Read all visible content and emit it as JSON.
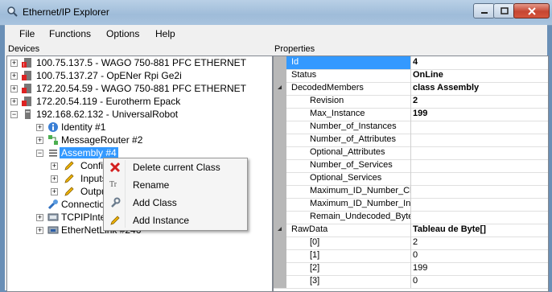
{
  "window": {
    "title": "Ethernet/IP Explorer"
  },
  "menu": [
    "File",
    "Functions",
    "Options",
    "Help"
  ],
  "panels": {
    "devices_label": "Devices",
    "properties_label": "Properties"
  },
  "tree": {
    "devices": [
      "100.75.137.5 - WAGO 750-881 PFC ETHERNET",
      "100.75.137.27 - OpENer Rpi Ge2i",
      "172.20.54.59 - WAGO 750-881 PFC ETHERNET",
      "172.20.54.119 - Eurotherm Epack",
      "192.168.62.132 - UniversalRobot"
    ],
    "children": [
      "Identity #1",
      "MessageRouter #2",
      "Assembly #4"
    ],
    "assembly_children": [
      "Config",
      "Inputs",
      "Outputs"
    ],
    "more": [
      "Connection",
      "TCPIPInterf",
      "EtherNetLink #246"
    ]
  },
  "context_menu": {
    "items": [
      "Delete current Class",
      "Rename",
      "Add Class",
      "Add Instance"
    ],
    "rename_glyph": "Tr"
  },
  "properties": [
    {
      "key": "Id",
      "value": "4"
    },
    {
      "key": "Status",
      "value": "OnLine"
    },
    {
      "key": "DecodedMembers",
      "value": "class Assembly"
    },
    {
      "key": "Revision",
      "value": "2"
    },
    {
      "key": "Max_Instance",
      "value": "199"
    },
    {
      "key": "Number_of_Instances",
      "value": ""
    },
    {
      "key": "Number_of_Attributes",
      "value": ""
    },
    {
      "key": "Optional_Attributes",
      "value": ""
    },
    {
      "key": "Number_of_Services",
      "value": ""
    },
    {
      "key": "Optional_Services",
      "value": ""
    },
    {
      "key": "Maximum_ID_Number_Cla",
      "value": ""
    },
    {
      "key": "Maximum_ID_Number_Ins",
      "value": ""
    },
    {
      "key": "Remain_Undecoded_Byte",
      "value": ""
    },
    {
      "key": "RawData",
      "value": "Tableau de Byte[]"
    },
    {
      "key": "[0]",
      "value": "2"
    },
    {
      "key": "[1]",
      "value": "0"
    },
    {
      "key": "[2]",
      "value": "199"
    },
    {
      "key": "[3]",
      "value": "0"
    }
  ]
}
